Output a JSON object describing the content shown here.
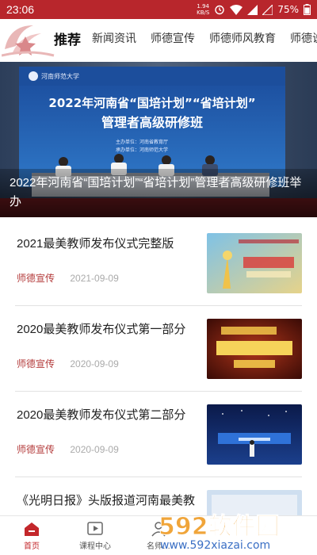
{
  "status_bar": {
    "time": "23:06",
    "net_speed_value": "1.94",
    "net_speed_unit": "KB/S",
    "battery": "75%"
  },
  "tabs": [
    {
      "label": "推荐",
      "active": true
    },
    {
      "label": "新闻资讯",
      "active": false
    },
    {
      "label": "师德宣传",
      "active": false
    },
    {
      "label": "师德师风教育",
      "active": false
    },
    {
      "label": "师德说",
      "active": false
    }
  ],
  "banner": {
    "caption": "2022年河南省“国培计划”“省培计划”管理者高级研修班举办",
    "screen_line1": "2022年河南省“国培计划”“省培计划”",
    "screen_line2": "管理者高级研修班",
    "screen_small_line1": "主办单位：河南省教育厅",
    "screen_small_line2": "承办单位：河南师范大学"
  },
  "news": [
    {
      "title": "2021最美教师发布仪式完整版",
      "category": "师德宣传",
      "date": "2021-09-09",
      "thumb": "thumb-2021"
    },
    {
      "title": "2020最美教师发布仪式第一部分",
      "category": "师德宣传",
      "date": "2020-09-09",
      "thumb": "thumb-2020-a"
    },
    {
      "title": "2020最美教师发布仪式第二部分",
      "category": "师德宣传",
      "date": "2020-09-09",
      "thumb": "thumb-2020-b"
    },
    {
      "title": "《光明日报》头版报道河南最美教",
      "category": "",
      "date": "",
      "thumb": "thumb-news"
    }
  ],
  "bottom_nav": [
    {
      "label": "首页",
      "icon": "home-icon",
      "active": true
    },
    {
      "label": "课程中心",
      "icon": "play-icon",
      "active": false
    },
    {
      "label": "名师…",
      "icon": "teacher-icon",
      "active": false
    }
  ],
  "watermark": {
    "brand": "592软件园",
    "url": "www.592xiazai.com"
  },
  "colors": {
    "brand_red": "#b8262c",
    "category_red": "#b33a3a"
  }
}
